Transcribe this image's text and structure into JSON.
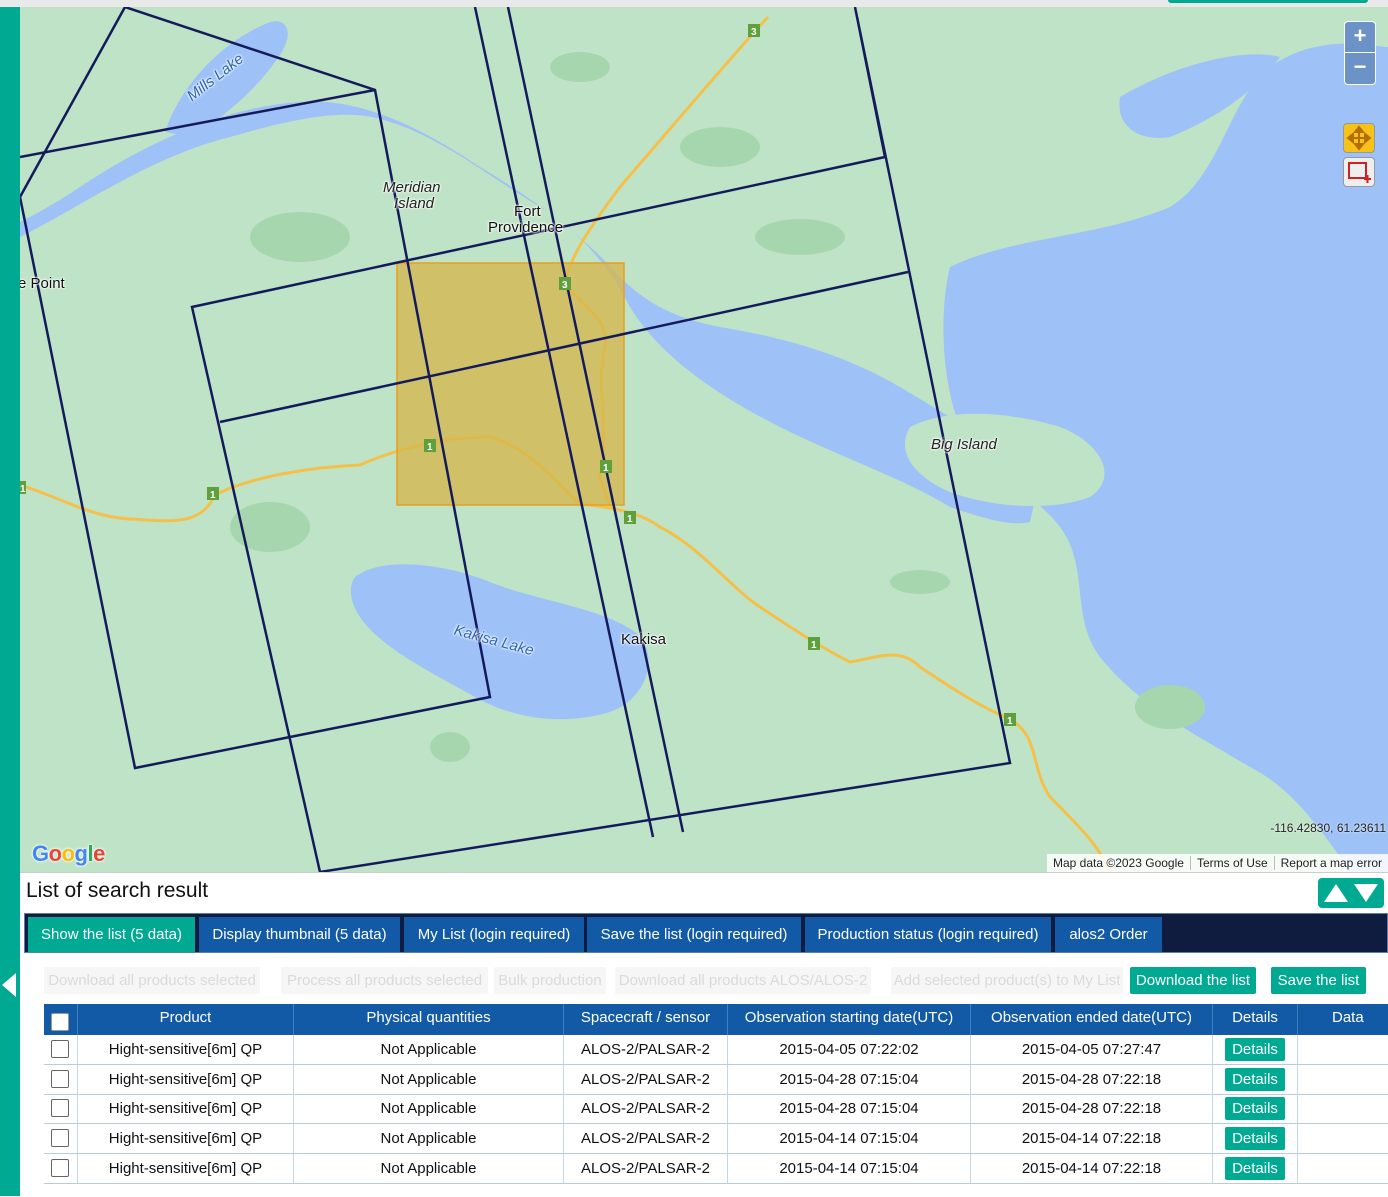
{
  "map": {
    "labels": {
      "mills_lake": "Mills Lake",
      "meridian_island_1": "Meridian",
      "meridian_island_2": "Island",
      "fort_providence_1": "Fort",
      "fort_providence_2": "Providence",
      "point": "e Point",
      "big_island": "Big Island",
      "kakisa_lake": "Kakisa Lake",
      "kakisa": "Kakisa"
    },
    "route_shields": [
      "3",
      "3",
      "1",
      "1",
      "1",
      "1",
      "1",
      "1",
      "1"
    ],
    "coordinates": "-116.42830, 61.23611",
    "google_logo": "Google",
    "footer": {
      "map_data": "Map data ©2023 Google",
      "terms": "Terms of Use",
      "report": "Report a map error"
    },
    "zoom_in": "+",
    "zoom_out": "−",
    "colors": {
      "land": "#bfe3c6",
      "water": "#9ec2f7",
      "footprint": "#151a5c",
      "aoi_fill": "#d6b64a",
      "aoi_border": "#e8a020",
      "road": "#f5c04a"
    }
  },
  "results": {
    "title": "List of search result",
    "tabs": [
      {
        "label": "Show the list (5 data)",
        "active": true
      },
      {
        "label": "Display thumbnail (5 data)",
        "active": false
      },
      {
        "label": "My List (login required)",
        "active": false
      },
      {
        "label": "Save the list (login required)",
        "active": false
      },
      {
        "label": "Production status (login required)",
        "active": false
      },
      {
        "label": "alos2 Order",
        "active": false
      }
    ],
    "actions": {
      "download_selected": "Download all products selected",
      "process_selected": "Process all products selected",
      "bulk_production": "Bulk production",
      "download_alos": "Download all products ALOS/ALOS-2",
      "add_mylist": "Add selected product(s) to My List",
      "download_list": "Download the list",
      "save_list": "Save the list"
    },
    "columns": [
      "Product",
      "Physical quantities",
      "Spacecraft / sensor",
      "Observation starting date(UTC)",
      "Observation ended date(UTC)",
      "Details",
      "Data"
    ],
    "rows": [
      {
        "product": "Hight-sensitive[6m] QP",
        "physical": "Not Applicable",
        "sensor": "ALOS-2/PALSAR-2",
        "start": "2015-04-05 07:22:02",
        "end": "2015-04-05 07:27:47",
        "details": "Details"
      },
      {
        "product": "Hight-sensitive[6m] QP",
        "physical": "Not Applicable",
        "sensor": "ALOS-2/PALSAR-2",
        "start": "2015-04-28 07:15:04",
        "end": "2015-04-28 07:22:18",
        "details": "Details"
      },
      {
        "product": "Hight-sensitive[6m] QP",
        "physical": "Not Applicable",
        "sensor": "ALOS-2/PALSAR-2",
        "start": "2015-04-28 07:15:04",
        "end": "2015-04-28 07:22:18",
        "details": "Details"
      },
      {
        "product": "Hight-sensitive[6m] QP",
        "physical": "Not Applicable",
        "sensor": "ALOS-2/PALSAR-2",
        "start": "2015-04-14 07:15:04",
        "end": "2015-04-14 07:22:18",
        "details": "Details"
      },
      {
        "product": "Hight-sensitive[6m] QP",
        "physical": "Not Applicable",
        "sensor": "ALOS-2/PALSAR-2",
        "start": "2015-04-14 07:15:04",
        "end": "2015-04-14 07:22:18",
        "details": "Details"
      }
    ]
  }
}
